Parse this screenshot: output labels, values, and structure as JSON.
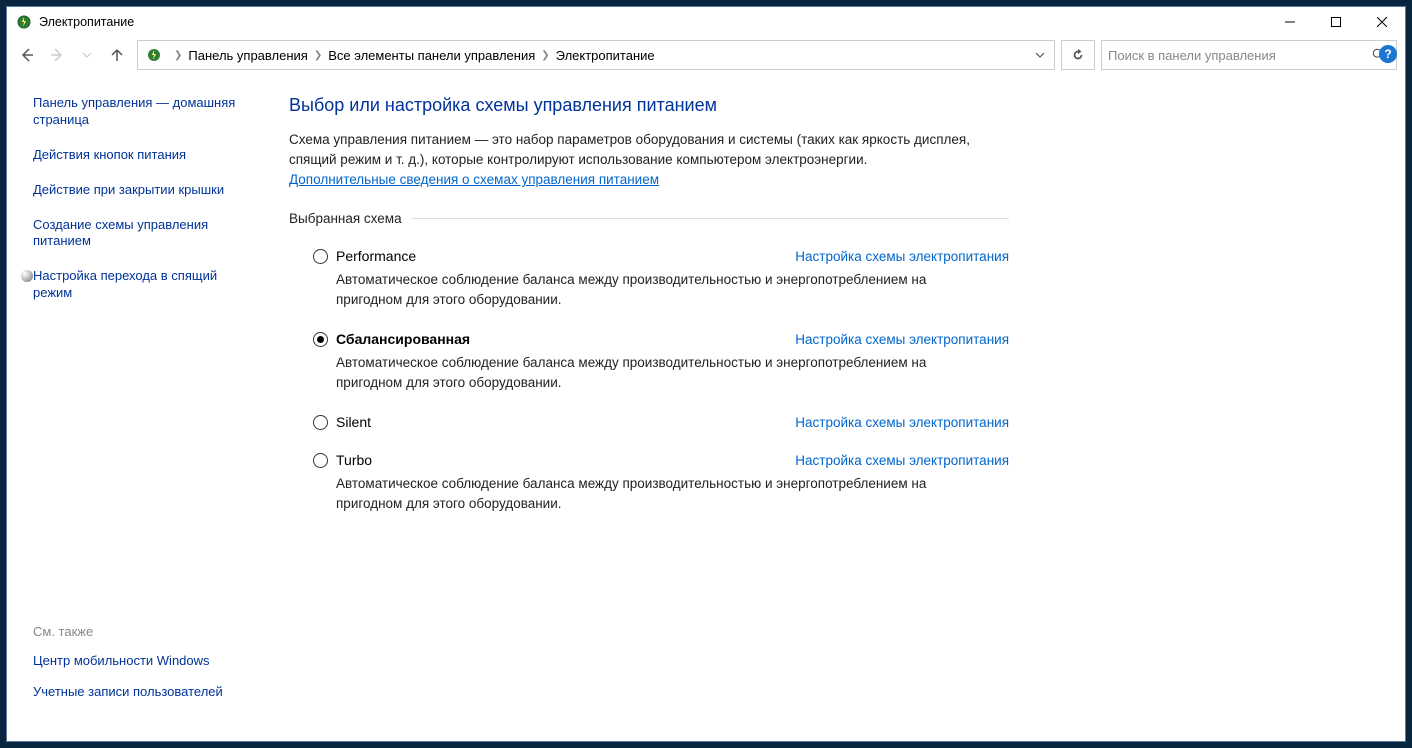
{
  "titlebar": {
    "title": "Электропитание"
  },
  "breadcrumb": {
    "items": [
      "Панель управления",
      "Все элементы панели управления",
      "Электропитание"
    ]
  },
  "search": {
    "placeholder": "Поиск в панели управления"
  },
  "sidebar": {
    "items": [
      "Панель управления — домашняя страница",
      "Действия кнопок питания",
      "Действие при закрытии крышки",
      "Создание схемы управления питанием",
      "Настройка перехода в спящий режим"
    ],
    "see_also_heading": "См. также",
    "see_also": [
      "Центр мобильности Windows",
      "Учетные записи пользователей"
    ]
  },
  "main": {
    "heading": "Выбор или настройка схемы управления питанием",
    "description": "Схема управления питанием — это набор параметров оборудования и системы (таких как яркость дисплея, спящий режим и т. д.), которые контролируют использование компьютером электроэнергии.",
    "more_info_link": "Дополнительные сведения о схемах управления питанием",
    "group_heading": "Выбранная схема",
    "config_link_text": "Настройка схемы электропитания",
    "plans": [
      {
        "name": "Performance",
        "selected": false,
        "description": "Автоматическое соблюдение баланса между производительностью и энергопотреблением на пригодном для этого оборудовании."
      },
      {
        "name": "Сбалансированная",
        "selected": true,
        "description": "Автоматическое соблюдение баланса между производительностью и энергопотреблением на пригодном для этого оборудовании."
      },
      {
        "name": "Silent",
        "selected": false,
        "description": ""
      },
      {
        "name": "Turbo",
        "selected": false,
        "description": "Автоматическое соблюдение баланса между производительностью и энергопотреблением на пригодном для этого оборудовании."
      }
    ]
  }
}
